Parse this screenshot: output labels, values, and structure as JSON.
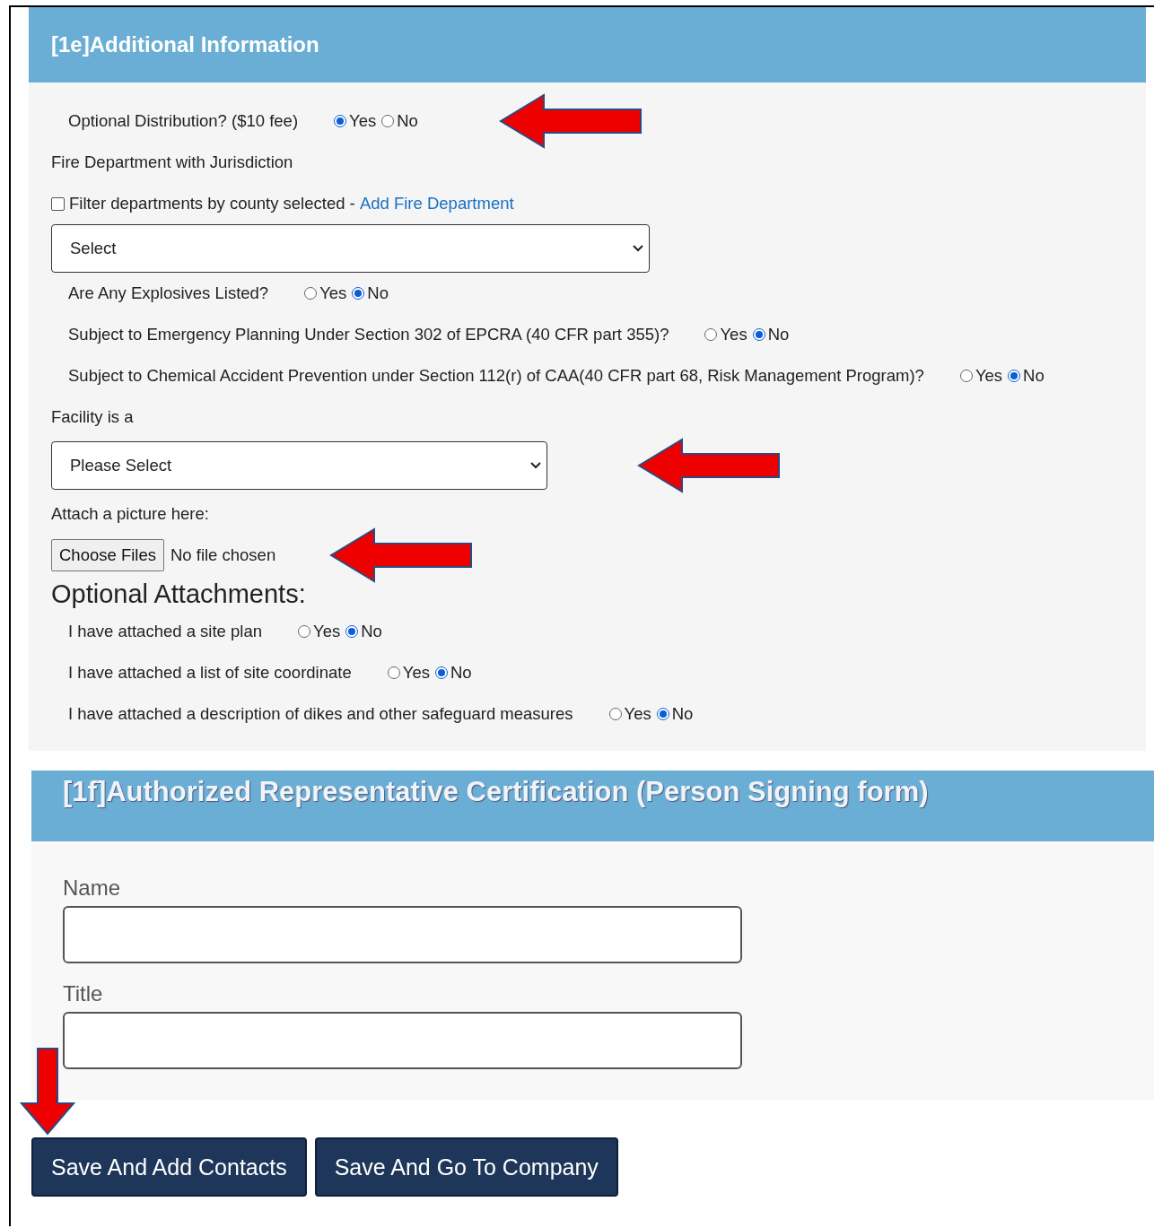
{
  "additional_information": {
    "title": "[1e]Additional Information",
    "items": [
      {
        "kind": "radio",
        "label": "Optional Distribution? ($10 fee)",
        "options": [
          {
            "label": "Yes",
            "selected": true
          },
          {
            "label": "No",
            "selected": false
          }
        ],
        "arrow": true
      },
      {
        "kind": "label",
        "text": "Fire Department with Jurisdiction"
      },
      {
        "kind": "checkbox",
        "label": "Filter departments by county selected - ",
        "checked": false,
        "link": "Add Fire Department"
      },
      {
        "kind": "select",
        "value": "Select"
      },
      {
        "kind": "radio",
        "label": "Are Any Explosives Listed?",
        "options": [
          {
            "label": "Yes",
            "selected": false
          },
          {
            "label": "No",
            "selected": true
          }
        ]
      },
      {
        "kind": "radio",
        "label": "Subject to Emergency Planning Under Section 302 of EPCRA (40 CFR part 355)?",
        "options": [
          {
            "label": "Yes",
            "selected": false
          },
          {
            "label": "No",
            "selected": true
          }
        ]
      },
      {
        "kind": "radio",
        "label": "Subject to Chemical Accident Prevention under Section 112(r) of CAA(40 CFR part 68, Risk Management Program)?",
        "options": [
          {
            "label": "Yes",
            "selected": false
          },
          {
            "label": "No",
            "selected": true
          }
        ]
      },
      {
        "kind": "label",
        "text": "Facility is a"
      },
      {
        "kind": "select",
        "value": "Please Select",
        "arrow": true
      },
      {
        "kind": "label",
        "text": "Attach a picture here:"
      },
      {
        "kind": "file",
        "button": "Choose Files",
        "status": "No file chosen",
        "arrow": true
      },
      {
        "kind": "heading",
        "text": "Optional Attachments:"
      },
      {
        "kind": "radio",
        "label": "I have attached a site plan",
        "options": [
          {
            "label": "Yes",
            "selected": false
          },
          {
            "label": "No",
            "selected": true
          }
        ]
      },
      {
        "kind": "radio",
        "label": "I have attached a list of site coordinate",
        "options": [
          {
            "label": "Yes",
            "selected": false
          },
          {
            "label": "No",
            "selected": true
          }
        ]
      },
      {
        "kind": "radio",
        "label": "I have attached a description of dikes and other safeguard measures",
        "options": [
          {
            "label": "Yes",
            "selected": false
          },
          {
            "label": "No",
            "selected": true
          }
        ]
      }
    ]
  },
  "certification": {
    "title": "[1f]Authorized Representative Certification (Person Signing form)",
    "fields": [
      {
        "label": "Name"
      },
      {
        "label": "Title"
      }
    ]
  },
  "buttons": [
    {
      "label": "Save And Add Contacts",
      "arrow": true
    },
    {
      "label": "Save And Go To Company"
    }
  ]
}
